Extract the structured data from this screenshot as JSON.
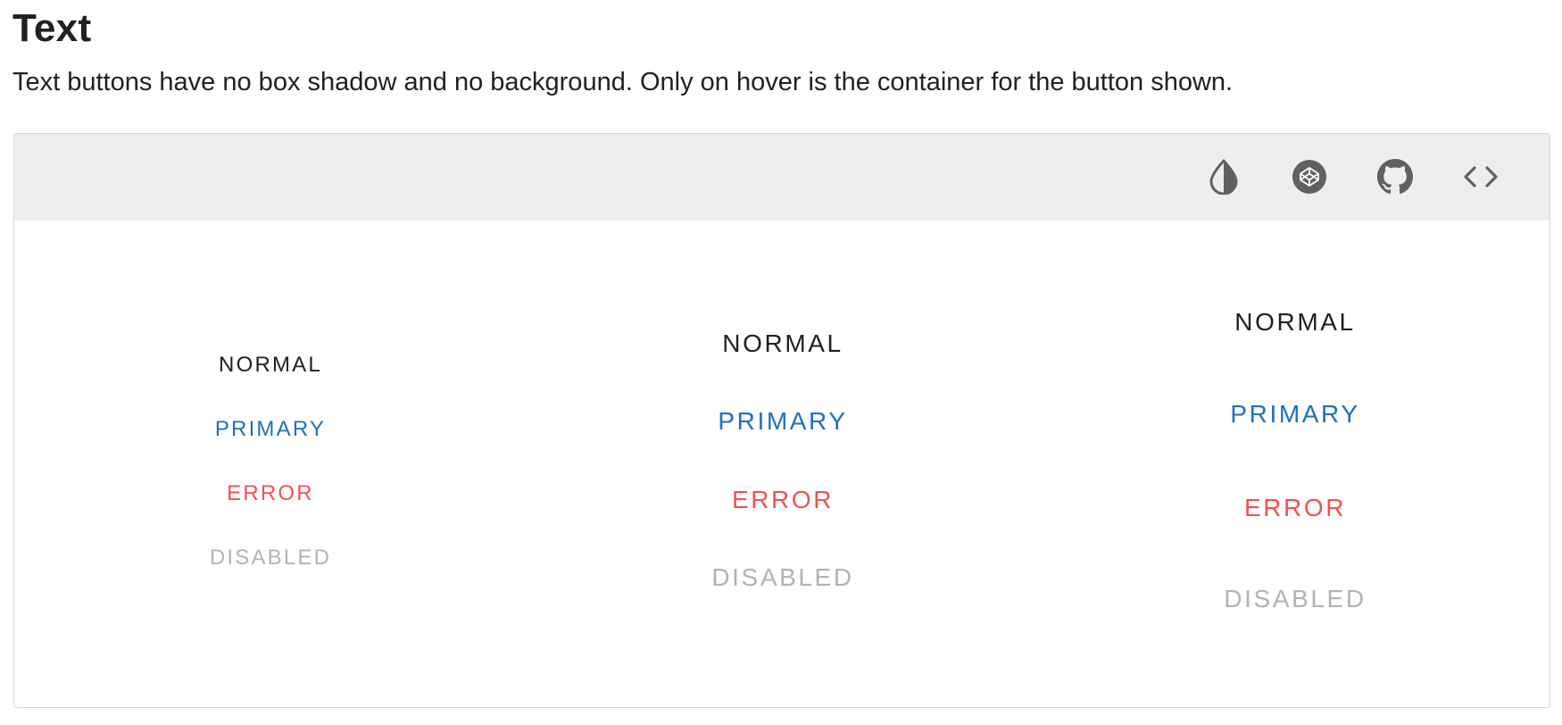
{
  "section": {
    "title": "Text",
    "description": "Text buttons have no box shadow and no background. Only on hover is the container for the button shown."
  },
  "toolbar": {
    "icons": [
      {
        "name": "invert-colors-icon",
        "semantic": "toggle theme"
      },
      {
        "name": "codepen-icon",
        "semantic": "edit in codepen"
      },
      {
        "name": "github-icon",
        "semantic": "view on github"
      },
      {
        "name": "code-icon",
        "semantic": "view source"
      }
    ],
    "icon_color": "#616161",
    "background": "#eeeeee"
  },
  "columns": [
    {
      "size": "small",
      "buttons": {
        "normal": "NORMAL",
        "primary": "PRIMARY",
        "error": "ERROR",
        "disabled": "DISABLED"
      }
    },
    {
      "size": "medium",
      "buttons": {
        "normal": "NORMAL",
        "primary": "PRIMARY",
        "error": "ERROR",
        "disabled": "DISABLED"
      }
    },
    {
      "size": "large",
      "buttons": {
        "normal": "NORMAL",
        "primary": "PRIMARY",
        "error": "ERROR",
        "disabled": "DISABLED"
      }
    }
  ],
  "colors": {
    "normal": "#212121",
    "primary": "#1f6fc0",
    "error": "#ef5350",
    "disabled": "#b3b3b3"
  }
}
